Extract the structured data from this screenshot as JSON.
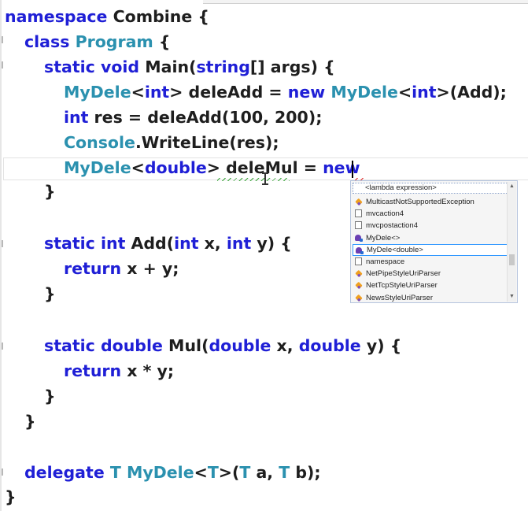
{
  "editor": {
    "lines": [
      [
        {
          "t": "namespace",
          "c": "kw"
        },
        {
          "t": " Combine {",
          "c": "txt"
        }
      ],
      [
        {
          "t": "class",
          "c": "kw"
        },
        {
          "t": " ",
          "c": "txt"
        },
        {
          "t": "Program",
          "c": "ty"
        },
        {
          "t": " {",
          "c": "txt"
        }
      ],
      [
        {
          "t": "static void",
          "c": "kw"
        },
        {
          "t": " Main(",
          "c": "txt"
        },
        {
          "t": "string",
          "c": "kw"
        },
        {
          "t": "[] args) {",
          "c": "txt"
        }
      ],
      [
        {
          "t": "MyDele",
          "c": "ty"
        },
        {
          "t": "<",
          "c": "txt"
        },
        {
          "t": "int",
          "c": "kw"
        },
        {
          "t": "> deleAdd = ",
          "c": "txt"
        },
        {
          "t": "new",
          "c": "kw"
        },
        {
          "t": " ",
          "c": "txt"
        },
        {
          "t": "MyDele",
          "c": "ty"
        },
        {
          "t": "<",
          "c": "txt"
        },
        {
          "t": "int",
          "c": "kw"
        },
        {
          "t": ">(Add);",
          "c": "txt"
        }
      ],
      [
        {
          "t": "int",
          "c": "kw"
        },
        {
          "t": " res = deleAdd(100, 200);",
          "c": "txt"
        }
      ],
      [
        {
          "t": "Console",
          "c": "ty"
        },
        {
          "t": ".WriteLine(res);",
          "c": "txt"
        }
      ],
      [
        {
          "t": "MyDele",
          "c": "ty"
        },
        {
          "t": "<",
          "c": "txt"
        },
        {
          "t": "double",
          "c": "kw"
        },
        {
          "t": "> deleMul = ",
          "c": "txt"
        },
        {
          "t": "new",
          "c": "kw"
        }
      ],
      [
        {
          "t": "}",
          "c": "txt"
        }
      ],
      [
        {
          "t": "static int",
          "c": "kw"
        },
        {
          "t": " Add(",
          "c": "txt"
        },
        {
          "t": "int",
          "c": "kw"
        },
        {
          "t": " x, ",
          "c": "txt"
        },
        {
          "t": "int",
          "c": "kw"
        },
        {
          "t": " y) {",
          "c": "txt"
        }
      ],
      [
        {
          "t": "return",
          "c": "kw"
        },
        {
          "t": " x + y;",
          "c": "txt"
        }
      ],
      [
        {
          "t": "}",
          "c": "txt"
        }
      ],
      [
        {
          "t": "static double",
          "c": "kw"
        },
        {
          "t": " Mul(",
          "c": "txt"
        },
        {
          "t": "double",
          "c": "kw"
        },
        {
          "t": " x, ",
          "c": "txt"
        },
        {
          "t": "double",
          "c": "kw"
        },
        {
          "t": " y) {",
          "c": "txt"
        }
      ],
      [
        {
          "t": "return",
          "c": "kw"
        },
        {
          "t": " x * y;",
          "c": "txt"
        }
      ],
      [
        {
          "t": "}",
          "c": "txt"
        }
      ],
      [
        {
          "t": "}",
          "c": "txt"
        }
      ],
      [
        {
          "t": "delegate",
          "c": "kw"
        },
        {
          "t": " ",
          "c": "txt"
        },
        {
          "t": "T",
          "c": "ty"
        },
        {
          "t": " ",
          "c": "txt"
        },
        {
          "t": "MyDele",
          "c": "ty"
        },
        {
          "t": "<",
          "c": "txt"
        },
        {
          "t": "T",
          "c": "ty"
        },
        {
          "t": ">(",
          "c": "txt"
        },
        {
          "t": "T",
          "c": "ty"
        },
        {
          "t": " a, ",
          "c": "txt"
        },
        {
          "t": "T",
          "c": "ty"
        },
        {
          "t": " b);",
          "c": "txt"
        }
      ],
      [
        {
          "t": "}",
          "c": "txt"
        }
      ]
    ]
  },
  "completion": {
    "header": "<lambda expression>",
    "items": [
      {
        "label": "MulticastNotSupportedException",
        "icon": "class-icon"
      },
      {
        "label": "mvcaction4",
        "icon": "snippet-icon"
      },
      {
        "label": "mvcpostaction4",
        "icon": "snippet-icon"
      },
      {
        "label": "MyDele<>",
        "icon": "delegate-icon"
      },
      {
        "label": "MyDele<double>",
        "icon": "delegate-icon",
        "selected": true
      },
      {
        "label": "namespace",
        "icon": "snippet-icon"
      },
      {
        "label": "NetPipeStyleUriParser",
        "icon": "class-icon"
      },
      {
        "label": "NetTcpStyleUriParser",
        "icon": "class-icon"
      },
      {
        "label": "NewsStyleUriParser",
        "icon": "class-icon"
      }
    ],
    "scroll_up_glyph": "▲",
    "scroll_down_glyph": "▼"
  }
}
